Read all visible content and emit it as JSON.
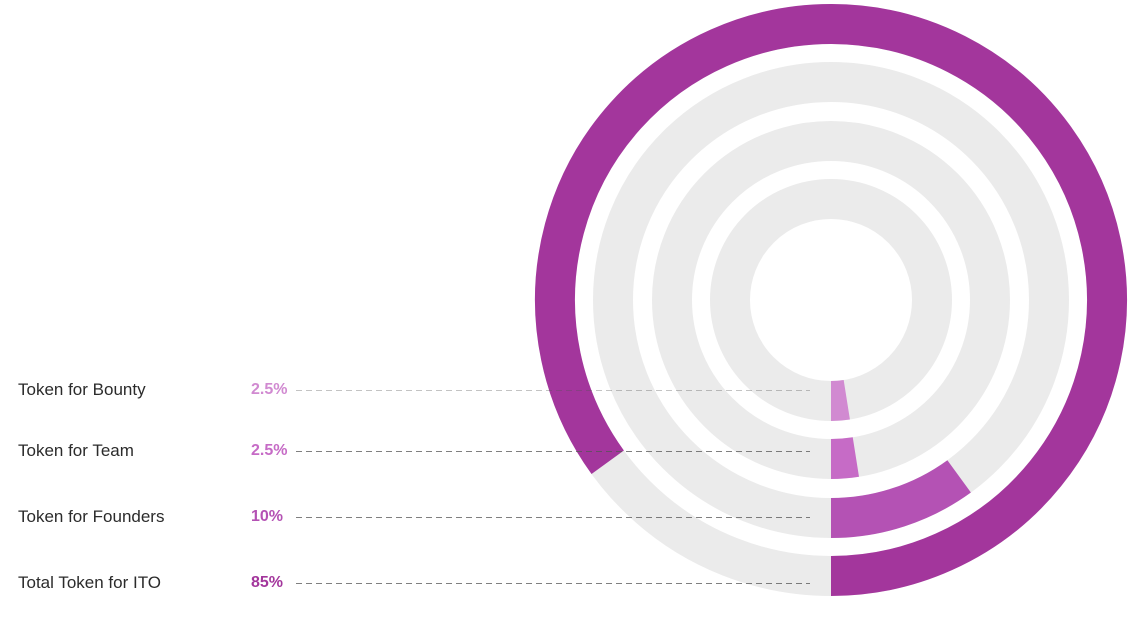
{
  "chart_data": {
    "type": "radial-bar",
    "title": "",
    "series": [
      {
        "label": "Token for Bounty",
        "value_label": "2.5%",
        "value": 2.5,
        "color": "#d18ad1"
      },
      {
        "label": "Token for Team",
        "value_label": "2.5%",
        "value": 2.5,
        "color": "#c66bc6"
      },
      {
        "label": "Token for Founders",
        "value_label": "10%",
        "value": 10,
        "color": "#b452b4"
      },
      {
        "label": "Total Token for ITO",
        "value_label": "85%",
        "value": 85,
        "color": "#a3369c"
      }
    ],
    "track_color": "#ebebeb",
    "leader_color": "#555555",
    "full_scale": 100,
    "start_angle": "bottom",
    "direction": "clockwise"
  }
}
